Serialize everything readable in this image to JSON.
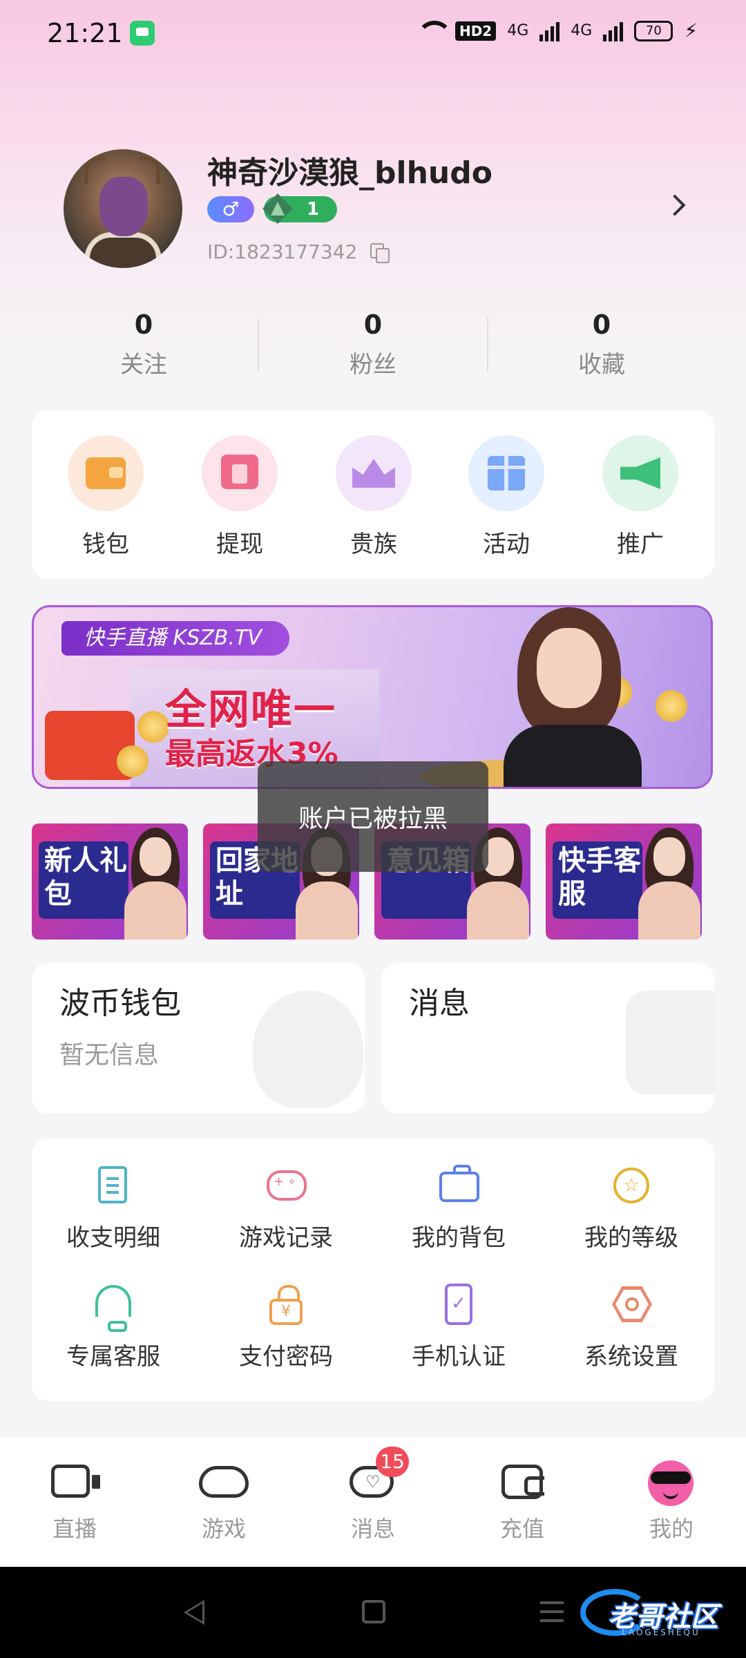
{
  "status_bar": {
    "time": "21:21",
    "hd": "HD2",
    "net1": "4G",
    "net2": "4G",
    "battery": "70"
  },
  "profile": {
    "username": "神奇沙漠狼_blhudo",
    "gender_symbol": "♂",
    "level": "1",
    "user_id": "ID:1823177342"
  },
  "stats": [
    {
      "value": "0",
      "label": "关注"
    },
    {
      "value": "0",
      "label": "粉丝"
    },
    {
      "value": "0",
      "label": "收藏"
    }
  ],
  "quick_actions": [
    {
      "label": "钱包",
      "icon": "wallet-icon",
      "color": "#fde9dc"
    },
    {
      "label": "提现",
      "icon": "withdraw-icon",
      "color": "#fde3ea"
    },
    {
      "label": "贵族",
      "icon": "crown-icon",
      "color": "#f3e6fb"
    },
    {
      "label": "活动",
      "icon": "gift-icon",
      "color": "#e4efff"
    },
    {
      "label": "推广",
      "icon": "megaphone-icon",
      "color": "#dff5e8"
    }
  ],
  "banner": {
    "tag": "快手直播 KSZB.TV",
    "line1": "全网唯一",
    "line2": "最高返水3%"
  },
  "thumbnails": [
    {
      "text": "新人礼包"
    },
    {
      "text": "回家地址"
    },
    {
      "text": "意见箱"
    },
    {
      "text": "快手客服"
    }
  ],
  "toast": "账户已被拉黑",
  "wallet_card": {
    "title": "波币钱包",
    "subtitle": "暂无信息"
  },
  "message_card": {
    "title": "消息"
  },
  "menu_grid": [
    {
      "label": "收支明细",
      "icon": "document-icon"
    },
    {
      "label": "游戏记录",
      "icon": "gamepad-icon"
    },
    {
      "label": "我的背包",
      "icon": "backpack-icon"
    },
    {
      "label": "我的等级",
      "icon": "level-star-icon"
    },
    {
      "label": "专属客服",
      "icon": "headset-icon"
    },
    {
      "label": "支付密码",
      "icon": "lock-icon"
    },
    {
      "label": "手机认证",
      "icon": "phone-check-icon"
    },
    {
      "label": "系统设置",
      "icon": "settings-hex-icon"
    }
  ],
  "bottom_nav": [
    {
      "label": "直播",
      "icon": "camera-icon"
    },
    {
      "label": "游戏",
      "icon": "gamepad-icon"
    },
    {
      "label": "消息",
      "icon": "chat-icon",
      "badge": "15"
    },
    {
      "label": "充值",
      "icon": "wallet-icon"
    },
    {
      "label": "我的",
      "icon": "avatar-face-icon"
    }
  ],
  "watermark": {
    "text": "老哥社区",
    "sub": "LAOGESHEQU"
  }
}
